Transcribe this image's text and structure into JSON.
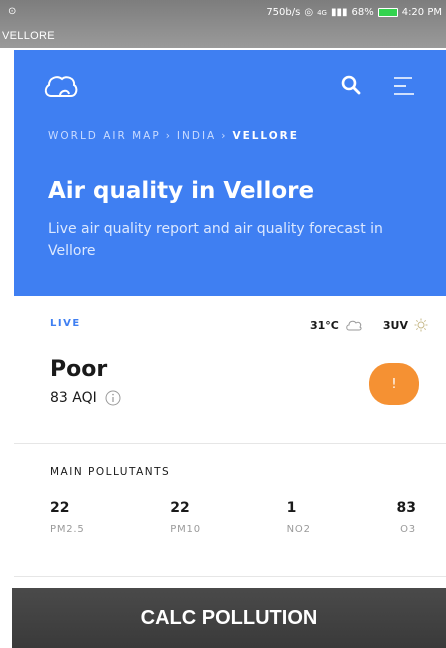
{
  "status_bar": {
    "speed": "750b/s",
    "signal": "4G",
    "battery": "68%",
    "time": "4:20 PM",
    "app_title": "VELLORE"
  },
  "header": {
    "breadcrumb": [
      "WORLD AIR MAP",
      "INDIA",
      "VELLORE"
    ],
    "breadcrumb_sep": "›",
    "title": "Air quality in Vellore",
    "subtitle": "Live air quality report and air quality forecast in Vellore",
    "accent_color": "#3f7ff2"
  },
  "live": {
    "label": "LIVE",
    "temperature": "31°C",
    "uv": "3UV",
    "status": "Poor",
    "aqi": "83 AQI",
    "badge": "!",
    "badge_color": "#f59133"
  },
  "pollutants": {
    "title": "MAIN POLLUTANTS",
    "items": [
      {
        "value": "22",
        "name": "PM2.5"
      },
      {
        "value": "22",
        "name": "PM10"
      },
      {
        "value": "1",
        "name": "NO2"
      },
      {
        "value": "83",
        "name": "O3"
      }
    ]
  },
  "footer": {
    "button_label": "CALC POLLUTION"
  }
}
